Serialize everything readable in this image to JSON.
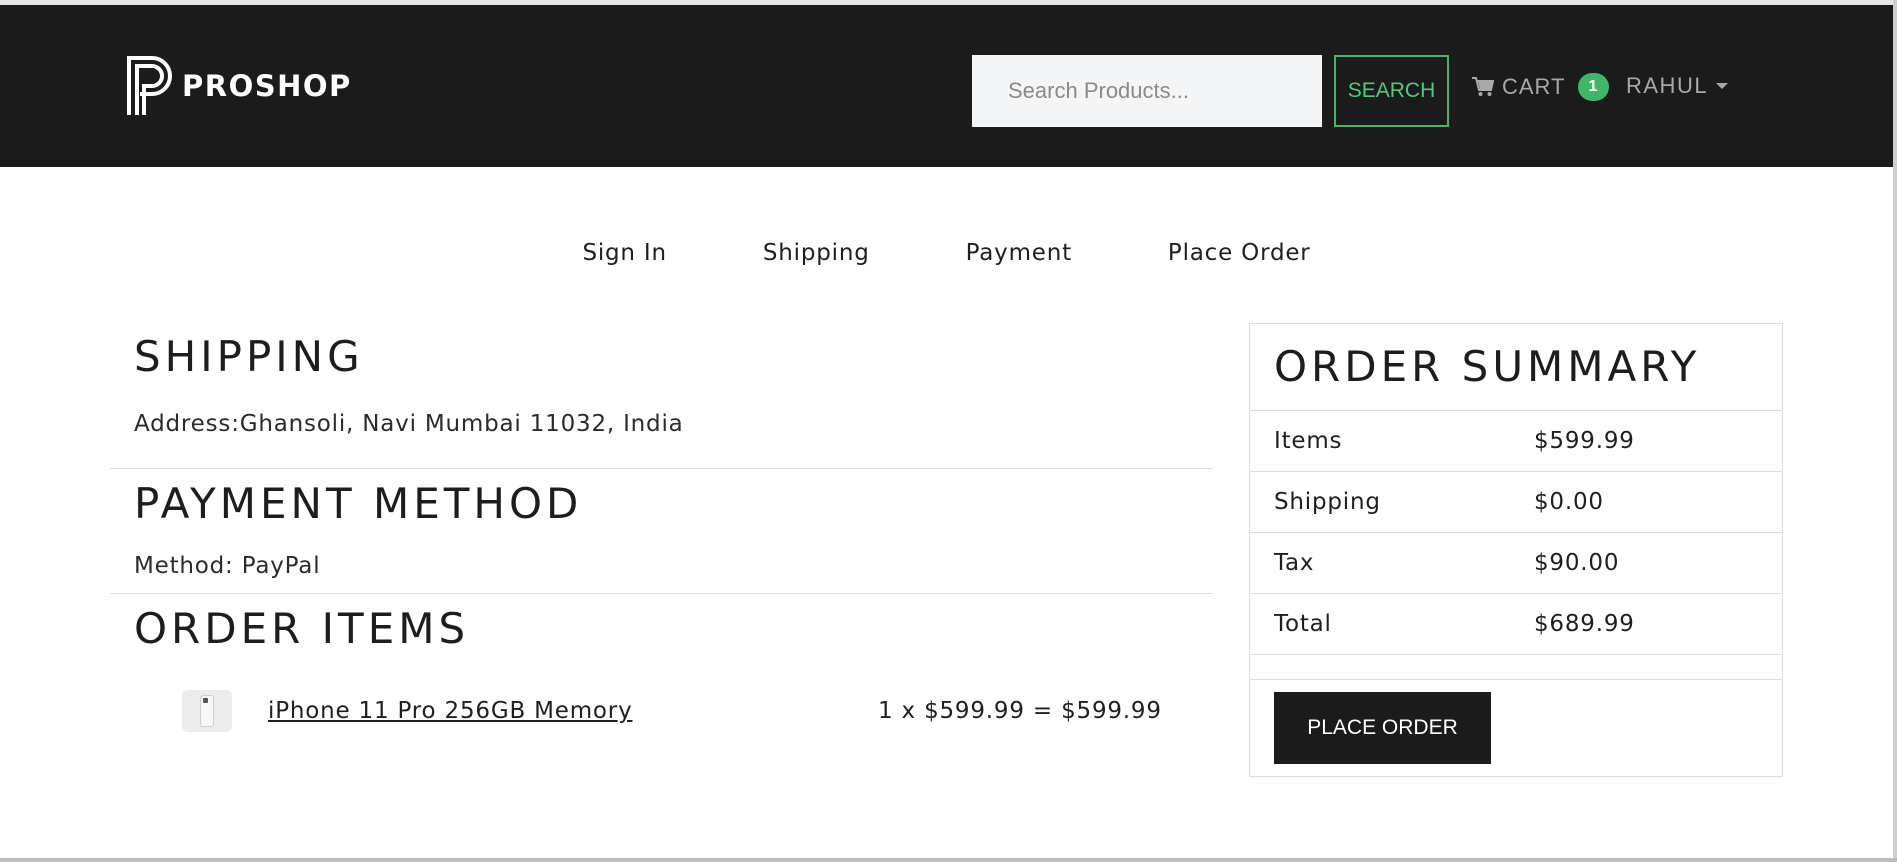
{
  "navbar": {
    "brand": "PROSHOP",
    "search_placeholder": "Search Products...",
    "search_button": "SEARCH",
    "cart_label": "CART",
    "cart_count": "1",
    "user_name": "RAHUL"
  },
  "steps": [
    "Sign In",
    "Shipping",
    "Payment",
    "Place Order"
  ],
  "shipping": {
    "heading": "SHIPPING",
    "address": "Address:Ghansoli, Navi Mumbai 11032, India"
  },
  "payment": {
    "heading": "PAYMENT METHOD",
    "method": "Method: PayPal"
  },
  "order_items": {
    "heading": "ORDER ITEMS",
    "items": [
      {
        "name": "iPhone 11 Pro 256GB Memory",
        "line_total": "1 x $599.99 = $599.99"
      }
    ]
  },
  "summary": {
    "heading": "ORDER SUMMARY",
    "rows": [
      {
        "label": "Items",
        "value": "$599.99"
      },
      {
        "label": "Shipping",
        "value": "$0.00"
      },
      {
        "label": "Tax",
        "value": "$90.00"
      },
      {
        "label": "Total",
        "value": "$689.99"
      }
    ],
    "place_order_button": "PLACE ORDER"
  },
  "colors": {
    "navbar_bg": "#1b1b1b",
    "accent_green": "#3fb768",
    "button_dark": "#1b1b1b"
  },
  "icons": {
    "brand": "proshop-logo-icon",
    "cart": "cart-icon",
    "user_caret": "chevron-down-icon"
  }
}
